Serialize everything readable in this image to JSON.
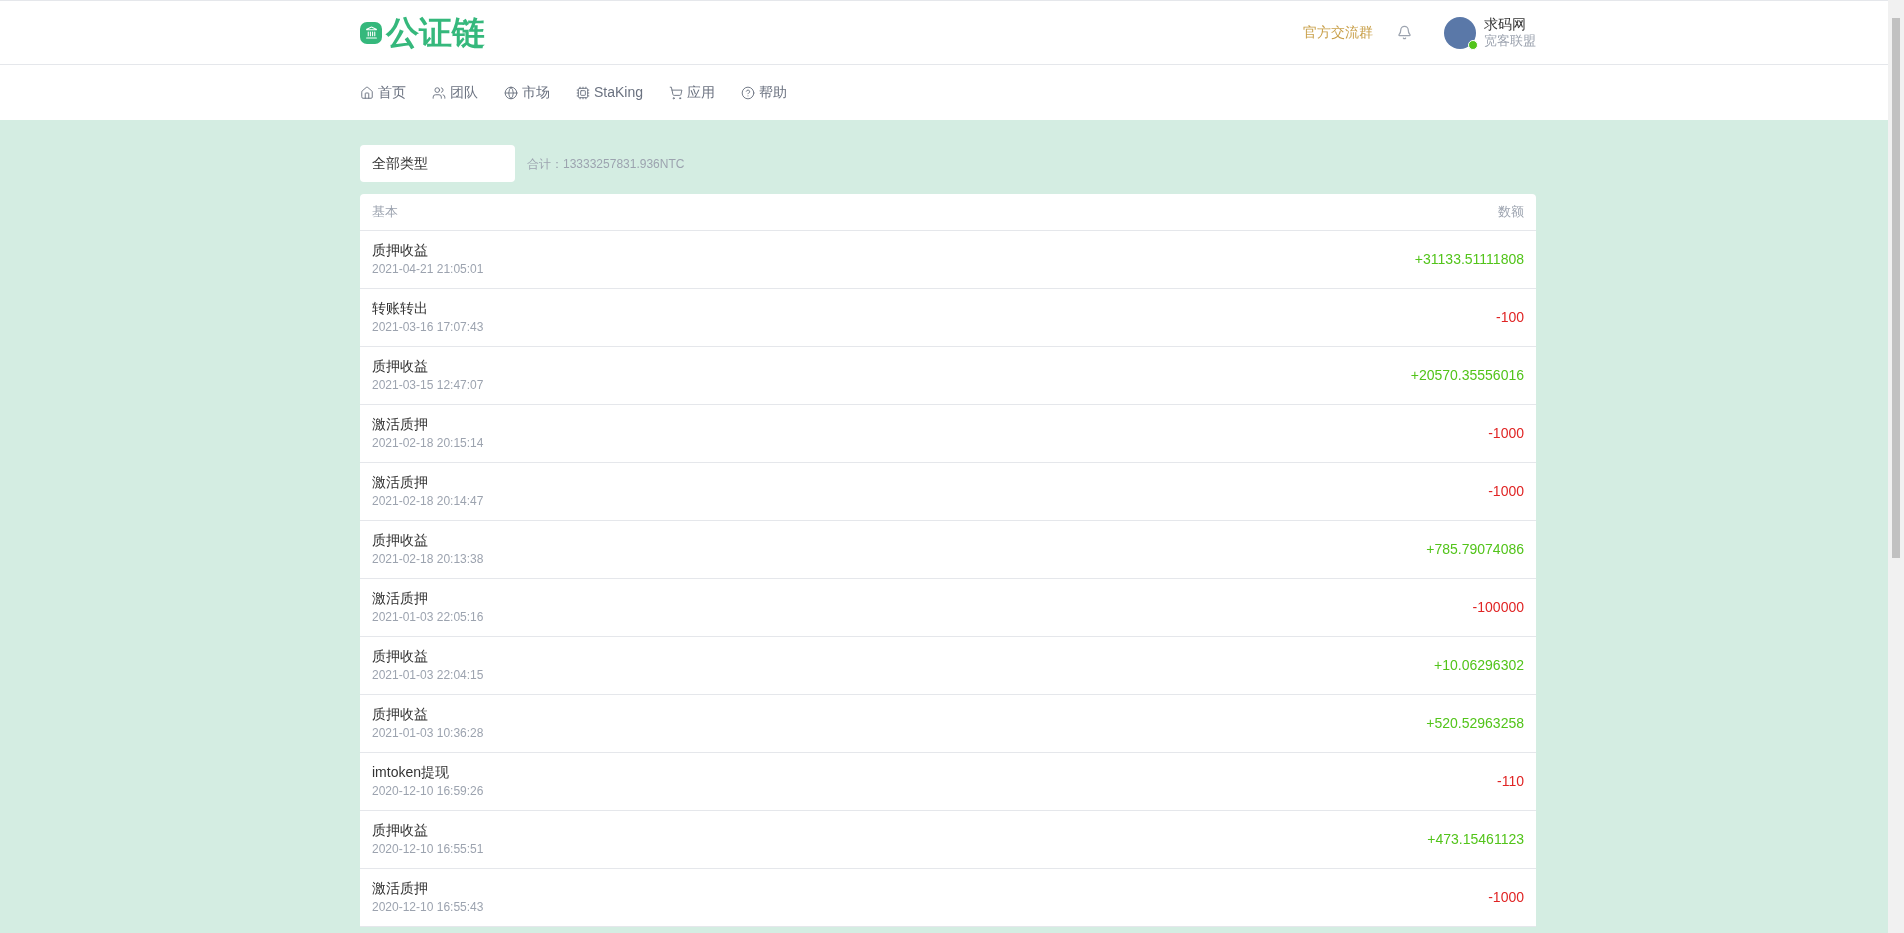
{
  "header": {
    "logo": "公证链",
    "group_link": "官方交流群",
    "user": {
      "name": "求码网",
      "subtitle": "宽客联盟",
      "online": true
    }
  },
  "nav": [
    {
      "label": "首页"
    },
    {
      "label": "团队"
    },
    {
      "label": "市场"
    },
    {
      "label": "StaKing"
    },
    {
      "label": "应用"
    },
    {
      "label": "帮助"
    }
  ],
  "filter": {
    "value": "全部类型",
    "total": "合计：13333257831.936NTC"
  },
  "table": {
    "columns": [
      "基本",
      "数额"
    ],
    "rows": [
      {
        "title": "质押收益",
        "time": "2021-04-21 21:05:01",
        "amount": "+31133.51111808",
        "kind": "credit"
      },
      {
        "title": "转账转出",
        "time": "2021-03-16 17:07:43",
        "amount": "-100",
        "kind": "debit"
      },
      {
        "title": "质押收益",
        "time": "2021-03-15 12:47:07",
        "amount": "+20570.35556016",
        "kind": "credit"
      },
      {
        "title": "激活质押",
        "time": "2021-02-18 20:15:14",
        "amount": "-1000",
        "kind": "debit"
      },
      {
        "title": "激活质押",
        "time": "2021-02-18 20:14:47",
        "amount": "-1000",
        "kind": "debit"
      },
      {
        "title": "质押收益",
        "time": "2021-02-18 20:13:38",
        "amount": "+785.79074086",
        "kind": "credit"
      },
      {
        "title": "激活质押",
        "time": "2021-01-03 22:05:16",
        "amount": "-100000",
        "kind": "debit"
      },
      {
        "title": "质押收益",
        "time": "2021-01-03 22:04:15",
        "amount": "+10.06296302",
        "kind": "credit"
      },
      {
        "title": "质押收益",
        "time": "2021-01-03 10:36:28",
        "amount": "+520.52963258",
        "kind": "credit"
      },
      {
        "title": "imtoken提现",
        "time": "2020-12-10 16:59:26",
        "amount": "-110",
        "kind": "debit"
      },
      {
        "title": "质押收益",
        "time": "2020-12-10 16:55:51",
        "amount": "+473.15461123",
        "kind": "credit"
      },
      {
        "title": "激活质押",
        "time": "2020-12-10 16:55:43",
        "amount": "-1000",
        "kind": "debit"
      }
    ]
  }
}
